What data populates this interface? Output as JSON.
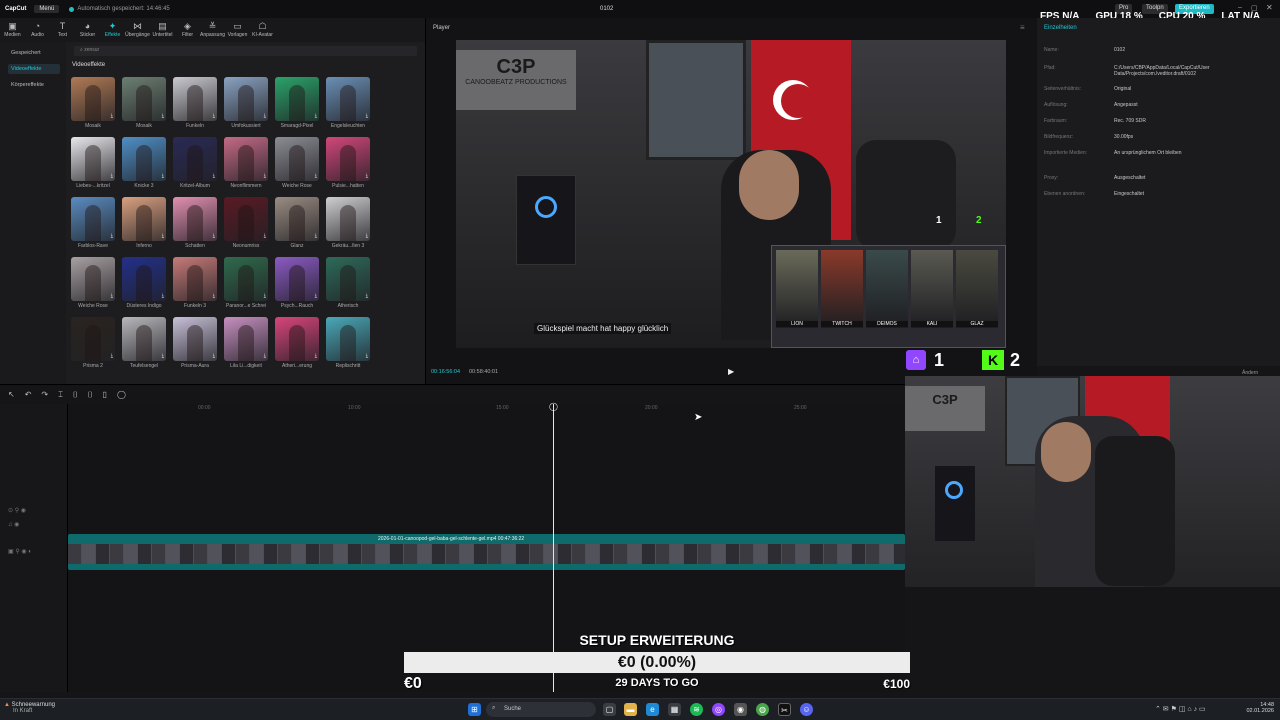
{
  "topbar": {
    "brand": "CapCut",
    "menu": "Menü",
    "autosave": "Automatisch gespeichert: 14:46:45",
    "project": "0102",
    "pro": "Pro",
    "tools_btn": "Toolpn",
    "export": "Exportieren"
  },
  "perf": {
    "fps_label": "FPS",
    "fps_value": "N/A",
    "gpu_label": "GPU",
    "gpu_value": "18 %",
    "cpu_label": "CPU",
    "cpu_value": "20 %",
    "lat_label": "LAT",
    "lat_value": "N/A"
  },
  "tools": [
    {
      "label": "Medien",
      "icon": "media-icon",
      "glyph": "▣"
    },
    {
      "label": "Audio",
      "icon": "audio-icon",
      "glyph": "◔"
    },
    {
      "label": "Text",
      "icon": "text-icon",
      "glyph": "T"
    },
    {
      "label": "Sticker",
      "icon": "sticker-icon",
      "glyph": "◕"
    },
    {
      "label": "Effekte",
      "icon": "effects-icon",
      "glyph": "✦",
      "active": true
    },
    {
      "label": "Übergänge",
      "icon": "transitions-icon",
      "glyph": "⋈"
    },
    {
      "label": "Untertitel",
      "icon": "captions-icon",
      "glyph": "▤"
    },
    {
      "label": "Filter",
      "icon": "filter-icon",
      "glyph": "◈"
    },
    {
      "label": "Anpassung",
      "icon": "adjust-icon",
      "glyph": "≚"
    },
    {
      "label": "Vorlagen",
      "icon": "templates-icon",
      "glyph": "▭"
    },
    {
      "label": "KI-Avatar",
      "icon": "ai-avatar-icon",
      "glyph": "☖"
    }
  ],
  "leftnav": {
    "saved": "Gespeichert",
    "video_effects": "Videoeffekte",
    "body_effects": "Körpereffekte"
  },
  "effects": {
    "search_placeholder": "zensur",
    "section_title": "Videoeffekte",
    "items": [
      {
        "label": "Mosaik",
        "color": "#b07a55"
      },
      {
        "label": "Mosaik",
        "color": "#6c7f72"
      },
      {
        "label": "Funkeln",
        "color": "#c9c9cf"
      },
      {
        "label": "Umfokussiert",
        "color": "#8aa2c2"
      },
      {
        "label": "Smaragd-Pixel",
        "color": "#2aa36a"
      },
      {
        "label": "Engelsleuchten",
        "color": "#6b8fb5"
      },
      {
        "label": "Liebes-...kritzel",
        "color": "#e8e8ec"
      },
      {
        "label": "Knicke 3",
        "color": "#4f8fc6"
      },
      {
        "label": "Kritzel-Album",
        "color": "#2a2a55"
      },
      {
        "label": "Neonflimmern",
        "color": "#c46a86"
      },
      {
        "label": "Weiche Rose",
        "color": "#8c8c94"
      },
      {
        "label": "Pulsie...hatten",
        "color": "#d2477a"
      },
      {
        "label": "Farblos-Rave",
        "color": "#5a8cc0"
      },
      {
        "label": "Inferno",
        "color": "#d9a080"
      },
      {
        "label": "Schatten",
        "color": "#e28fb0"
      },
      {
        "label": "Neonumriss",
        "color": "#5a1a24"
      },
      {
        "label": "Glanz",
        "color": "#9a8c82"
      },
      {
        "label": "Gekräu...llen 3",
        "color": "#cfcfd2"
      },
      {
        "label": "Weiche Rose",
        "color": "#a8a0a2"
      },
      {
        "label": "Düsteres Indigo",
        "color": "#23308a"
      },
      {
        "label": "Funkeln 3",
        "color": "#c67a78"
      },
      {
        "label": "Paranor...e Schrei",
        "color": "#2f6a4c"
      },
      {
        "label": "Psych...Rauch",
        "color": "#8b5ac4"
      },
      {
        "label": "Ätherisch",
        "color": "#2e6a5a"
      },
      {
        "label": "Prisma 2",
        "color": "#2a2420"
      },
      {
        "label": "Teufelsengel",
        "color": "#b8b8bc"
      },
      {
        "label": "Prisma-Aura",
        "color": "#c8c0d8"
      },
      {
        "label": "Lila Li...digkeit",
        "color": "#c690c0"
      },
      {
        "label": "Ätheri...erung",
        "color": "#d8457a"
      },
      {
        "label": "Replischritt",
        "color": "#4aa8b8"
      }
    ]
  },
  "player": {
    "title": "Player",
    "current_time": "00:16:56:04",
    "total_time": "00:58:40:01",
    "stream_logo": "C3P",
    "stream_logo_sub": "CANOOBEATZ PRODUCTIONS",
    "caption": "Glückspiel macht hat happy glücklich",
    "score_1": "1",
    "score_2": "2",
    "operators": [
      "LION",
      "TWITCH",
      "DEIMOS",
      "KALI",
      "GLAZ"
    ]
  },
  "details": {
    "tab": "Einzelheiten",
    "rows": [
      {
        "k": "Name:",
        "v": "0102"
      },
      {
        "k": "Pfad:",
        "v": "C:/Users/CBP/AppData/Local/CapCut/User Data/Projects/com.lveditor.draft/0102"
      },
      {
        "k": "Seitenverhältnis:",
        "v": "Original"
      },
      {
        "k": "Auflösung:",
        "v": "Angepasst"
      },
      {
        "k": "Farbraum:",
        "v": "Rec. 709 SDR"
      },
      {
        "k": "Bildfrequenz:",
        "v": "30.00fps"
      },
      {
        "k": "Importierte Medien:",
        "v": "An ursprünglichem Ort bleiben"
      },
      {
        "k": "Proxy:",
        "v": "Ausgeschaltet"
      },
      {
        "k": "Ebenen anordnen:",
        "v": "Eingeschaltet"
      }
    ],
    "edit": "Ändern"
  },
  "timeline": {
    "ruler_ticks": [
      "00:00",
      "10:00",
      "15:00",
      "20:00",
      "25:00"
    ],
    "clip_label": "2026-01-01-canoopod-gel-baba-gel-schlente-gel.mp4   00:47:36:22",
    "small_labels": [
      "2",
      "2026",
      "2026",
      "2026",
      "2026-01",
      "20",
      "2",
      "202",
      "21",
      "2026-01-01",
      "2026-",
      "202",
      "2026-01-01"
    ]
  },
  "overlay": {
    "twitch_count": "1",
    "kick_count": "2",
    "goal_title": "SETUP ERWEITERUNG",
    "goal_progress_text": "€0 (0.00%)",
    "goal_progress": 0.0,
    "goal_min": "€0",
    "goal_days": "29 DAYS TO GO",
    "goal_max": "€100"
  },
  "taskbar": {
    "weather_title": "Schneewarnung",
    "weather_sub": "In Kraft",
    "search": "Suche",
    "time": "14:48",
    "date": "02.01.2026"
  },
  "colors": {
    "accent": "#1fb9c6",
    "clip": "#0f6a6b",
    "twitch": "#9146ff",
    "kick": "#53fc18"
  }
}
